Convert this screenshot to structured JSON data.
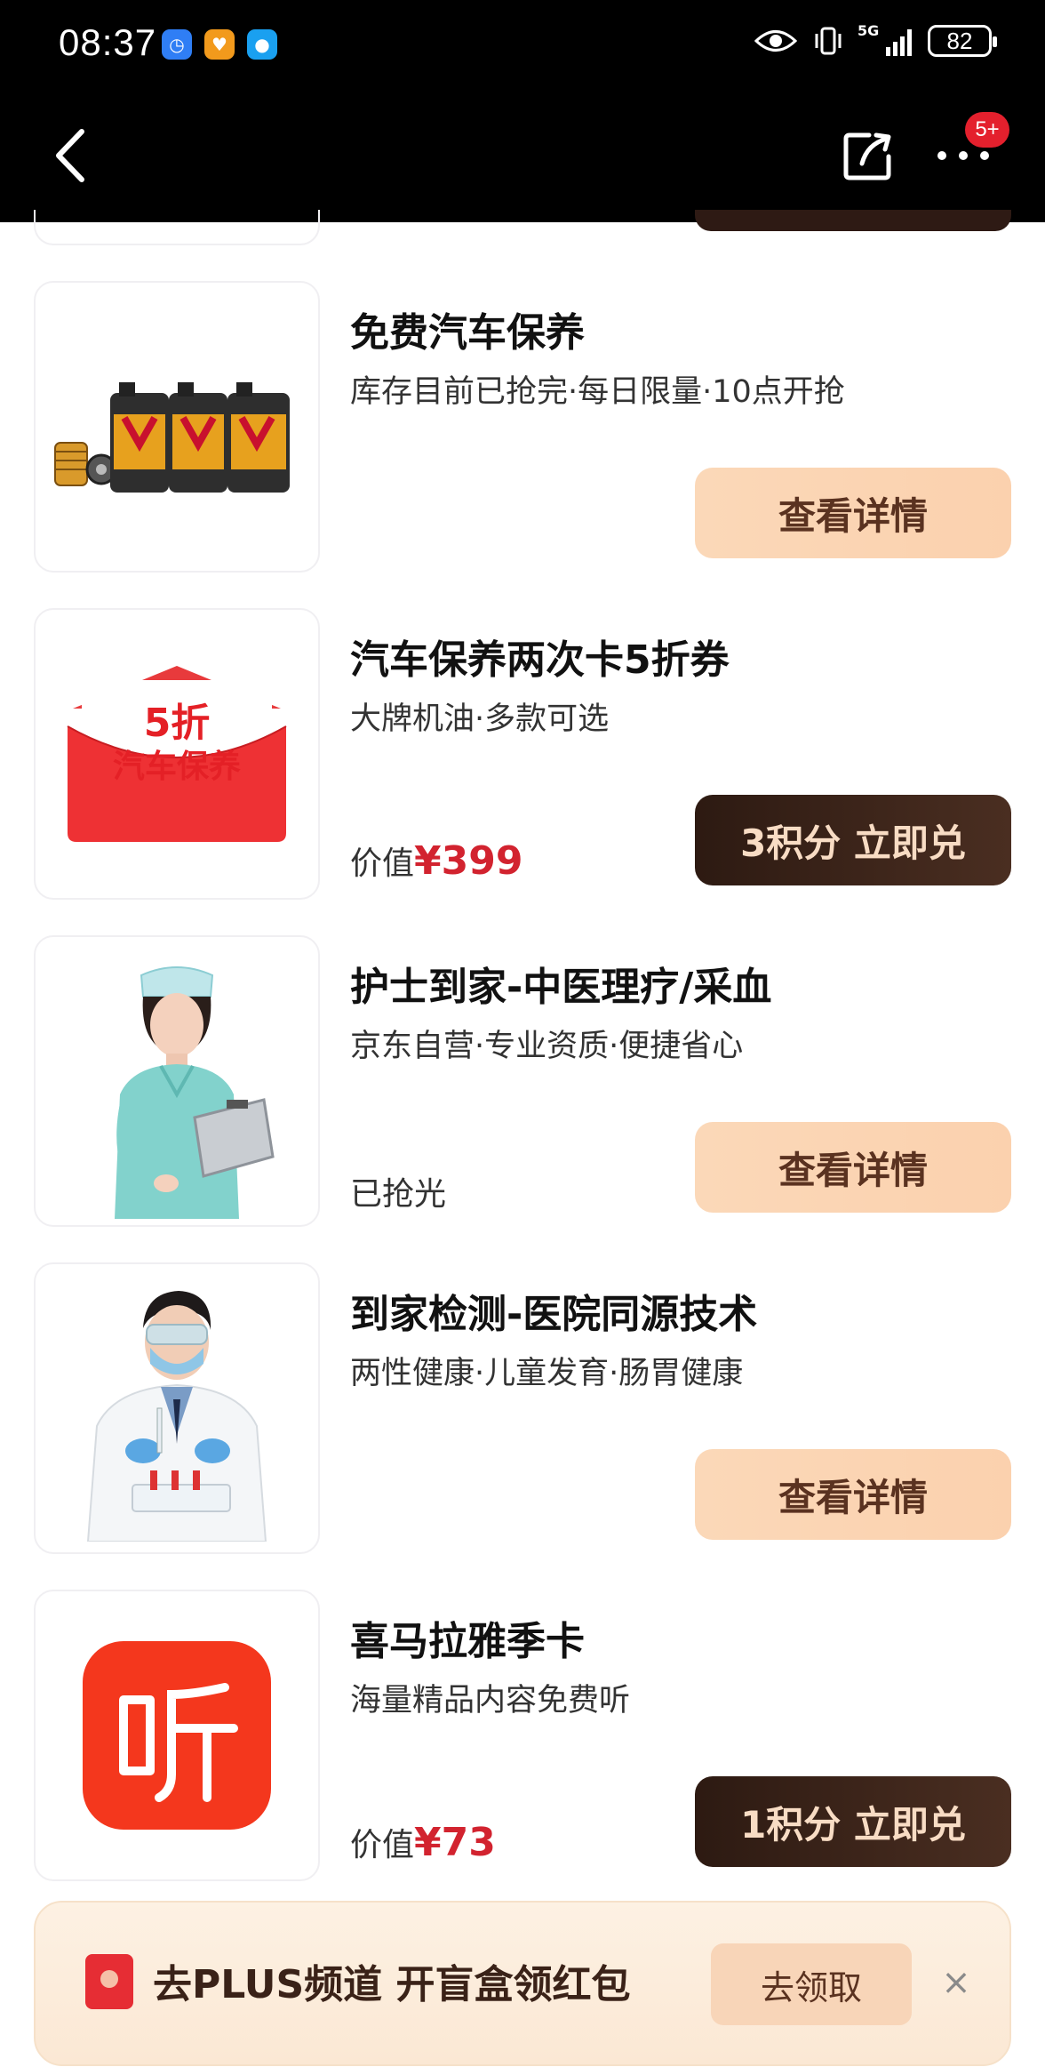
{
  "status_bar": {
    "time": "08:37",
    "network": "5G",
    "battery": "82"
  },
  "nav": {
    "badge": "5+"
  },
  "items": [
    {
      "title": "免费汽车保养",
      "subtitle": "库存目前已抢完·每日限量·10点开抢",
      "button": "查看详情",
      "image": "engine-oil-bottles"
    },
    {
      "title": "汽车保养两次卡5折券",
      "subtitle": "大牌机油·多款可选",
      "value_label": "价值",
      "price": "¥399",
      "button": "3积分 立即兑",
      "thumb_text_1": "5折",
      "thumb_text_2": "汽车保养",
      "image": "red-envelope-coupon"
    },
    {
      "title": "护士到家-中医理疗/采血",
      "subtitle": "京东自营·专业资质·便捷省心",
      "status": "已抢光",
      "button": "查看详情",
      "image": "nurse-photo"
    },
    {
      "title": "到家检测-医院同源技术",
      "subtitle": "两性健康·儿童发育·肠胃健康",
      "button": "查看详情",
      "image": "lab-doctor-photo"
    },
    {
      "title": "喜马拉雅季卡",
      "subtitle": "海量精品内容免费听",
      "value_label": "价值",
      "price": "¥73",
      "button": "1积分 立即兑",
      "image": "ximalaya-logo"
    }
  ],
  "banner": {
    "text": "去PLUS频道 开盲盒领红包",
    "button": "去领取",
    "close": "×"
  },
  "colors": {
    "accent_red": "#d2232f",
    "button_light": "#fbd8b8",
    "button_dark": "#2d1a12"
  }
}
